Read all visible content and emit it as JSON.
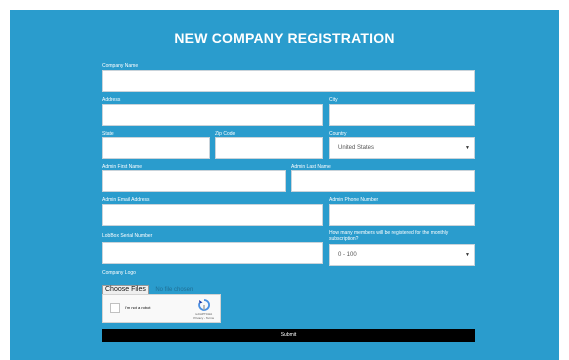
{
  "form": {
    "title": "NEW COMPANY REGISTRATION",
    "fields": {
      "company_name": {
        "label": "Company Name",
        "value": ""
      },
      "address": {
        "label": "Address",
        "value": ""
      },
      "city": {
        "label": "City",
        "value": ""
      },
      "state": {
        "label": "State",
        "value": ""
      },
      "zip": {
        "label": "Zip Code",
        "value": ""
      },
      "country": {
        "label": "Country",
        "value": "United States"
      },
      "admin_first": {
        "label": "Admin First Name",
        "value": ""
      },
      "admin_last": {
        "label": "Admin Last Name",
        "value": ""
      },
      "admin_email": {
        "label": "Admin Email Address",
        "value": ""
      },
      "admin_phone": {
        "label": "Admin Phone Number",
        "value": ""
      },
      "serial": {
        "label": "LobBox Serial Number",
        "value": ""
      },
      "members": {
        "label": "How many members will be registered for the monthly subscription?",
        "value": "0 - 100"
      }
    },
    "logo": {
      "label": "Company Logo",
      "button": "Choose Files",
      "status": "No file chosen"
    },
    "captcha": {
      "label": "I'm not a robot",
      "brand": "reCAPTCHA",
      "links": "Privacy - Terms"
    },
    "submit": "Submit"
  },
  "colors": {
    "background": "#2a9ccd",
    "submit": "#000000"
  }
}
